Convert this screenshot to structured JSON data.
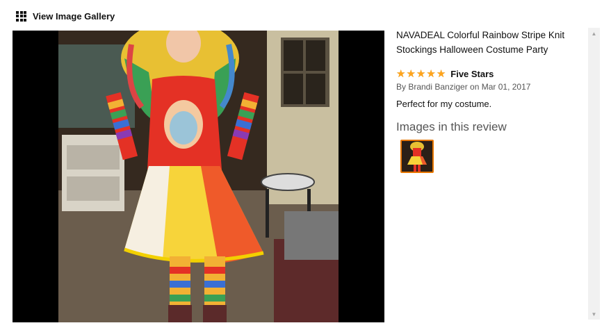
{
  "header": {
    "title": "View Image Gallery",
    "icon": "grid-icon"
  },
  "review": {
    "product_title": "NAVADEAL Colorful Rainbow Stripe Knit Stockings Halloween Costume Party",
    "rating": 5,
    "rating_max": 5,
    "headline": "Five Stars",
    "byline": "By Brandi Banziger on Mar 01, 2017",
    "body": "Perfect for my costume.",
    "images_heading": "Images in this review"
  },
  "colors": {
    "star": "#ffa41c",
    "thumb_border": "#e77600"
  }
}
